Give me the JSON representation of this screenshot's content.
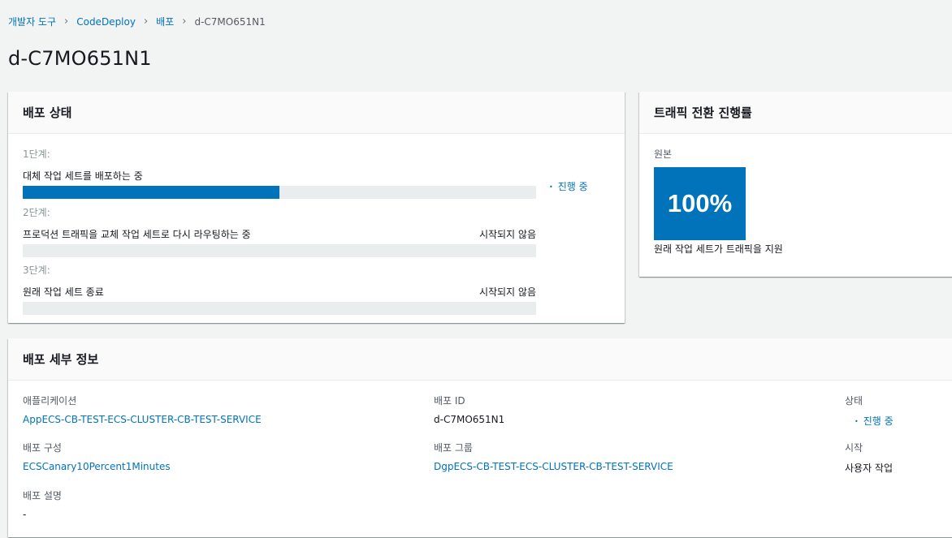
{
  "breadcrumb": {
    "items": [
      "개발자 도구",
      "CodeDeploy",
      "배포"
    ],
    "current": "d-C7MO651N1"
  },
  "page_title": "d-C7MO651N1",
  "status_panel": {
    "title": "배포 상태",
    "steps": [
      {
        "label": "1단계:",
        "desc": "대체 작업 세트를 배포하는 중",
        "status": "진행 중",
        "progress": 0.5
      },
      {
        "label": "2단계:",
        "desc": "프로덕션 트래픽을 교체 작업 세트로 다시 라우팅하는 중",
        "status": "시작되지 않음",
        "progress": 0
      },
      {
        "label": "3단계:",
        "desc": "원래 작업 세트 종료",
        "status": "시작되지 않음",
        "progress": 0
      }
    ]
  },
  "traffic_panel": {
    "title": "트래픽 전환 진행률",
    "original_label": "원본",
    "percent": "100%",
    "caption": "원래 작업 세트가 트래픽을 지원"
  },
  "details_panel": {
    "title": "배포 세부 정보",
    "application_label": "애플리케이션",
    "application_value": "AppECS-CB-TEST-ECS-CLUSTER-CB-TEST-SERVICE",
    "deployment_id_label": "배포 ID",
    "deployment_id_value": "d-C7MO651N1",
    "status_label": "상태",
    "status_value": "진행 중",
    "config_label": "배포 구성",
    "config_value": "ECSCanary10Percent1Minutes",
    "group_label": "배포 그룹",
    "group_value": "DgpECS-CB-TEST-ECS-CLUSTER-CB-TEST-SERVICE",
    "initiated_label": "시작",
    "initiated_value": "사용자 작업",
    "description_label": "배포 설명",
    "description_value": "-"
  },
  "colors": {
    "accent": "#0073bb",
    "background": "#f2f3f3"
  }
}
